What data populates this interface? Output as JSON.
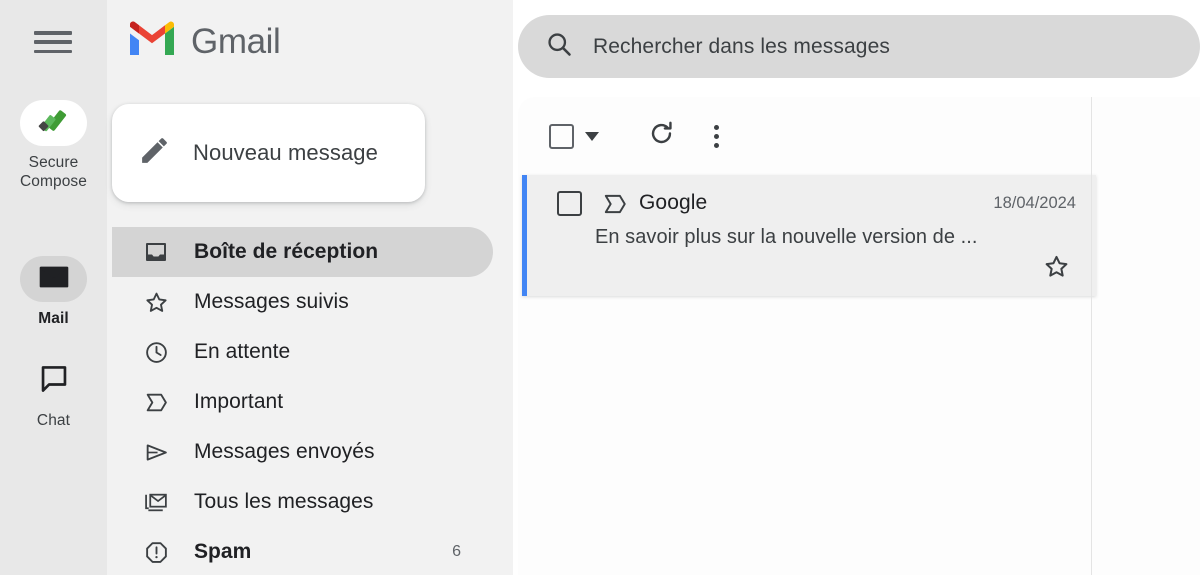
{
  "rail": {
    "menu_icon": "hamburger-menu-icon",
    "items": [
      {
        "id": "secure-compose",
        "icon": "secure-compose-icon",
        "label": "Secure\nCompose",
        "label_line1": "Secure",
        "label_line2": "Compose",
        "active": false,
        "pill": "white"
      },
      {
        "id": "mail",
        "icon": "mail-envelope-icon",
        "label": "Mail",
        "active": true,
        "pill": "gray"
      },
      {
        "id": "chat",
        "icon": "chat-bubble-icon",
        "label": "Chat",
        "active": false,
        "pill": "none"
      }
    ]
  },
  "sidebar": {
    "brand": "Gmail",
    "brand_logo": "gmail-m-logo",
    "compose": {
      "label": "Nouveau message",
      "icon": "pencil-icon"
    },
    "nav": [
      {
        "id": "inbox",
        "label": "Boîte de réception",
        "icon": "inbox-icon",
        "active": true,
        "bold": true,
        "count": ""
      },
      {
        "id": "starred",
        "label": "Messages suivis",
        "icon": "star-icon",
        "active": false,
        "bold": false,
        "count": ""
      },
      {
        "id": "snoozed",
        "label": "En attente",
        "icon": "clock-icon",
        "active": false,
        "bold": false,
        "count": ""
      },
      {
        "id": "important",
        "label": "Important",
        "icon": "important-icon",
        "active": false,
        "bold": false,
        "count": ""
      },
      {
        "id": "sent",
        "label": "Messages envoyés",
        "icon": "send-icon",
        "active": false,
        "bold": false,
        "count": ""
      },
      {
        "id": "all-mail",
        "label": "Tous les messages",
        "icon": "all-mail-icon",
        "active": false,
        "bold": false,
        "count": ""
      },
      {
        "id": "spam",
        "label": "Spam",
        "icon": "spam-icon",
        "active": false,
        "bold": true,
        "count": "6"
      }
    ]
  },
  "search": {
    "placeholder": "Rechercher dans les messages",
    "icon": "search-icon",
    "value": ""
  },
  "toolbar": {
    "select_all_icon": "checkbox-icon",
    "select_caret_icon": "chevron-down-icon",
    "refresh_icon": "refresh-icon",
    "more_icon": "more-vertical-icon"
  },
  "emails": [
    {
      "sender": "Google",
      "snippet": "En savoir plus sur la nouvelle version de ...",
      "date": "18/04/2024",
      "checkbox_icon": "checkbox-icon",
      "important_icon": "important-icon",
      "star_icon": "star-outline-icon",
      "selected": true,
      "accent_color": "#4285F4"
    }
  ],
  "colors": {
    "rail_bg": "#E8E8E8",
    "sidebar_bg": "#F2F2F2",
    "panel_bg": "#FDFDFD",
    "search_bg": "#D9D9D9",
    "active_pill": "#D4D4D4",
    "accent_blue": "#4285F4",
    "row_bg": "#EFEFEF",
    "icon_gray": "#3C4043",
    "secure_green": "#3F9C35"
  }
}
